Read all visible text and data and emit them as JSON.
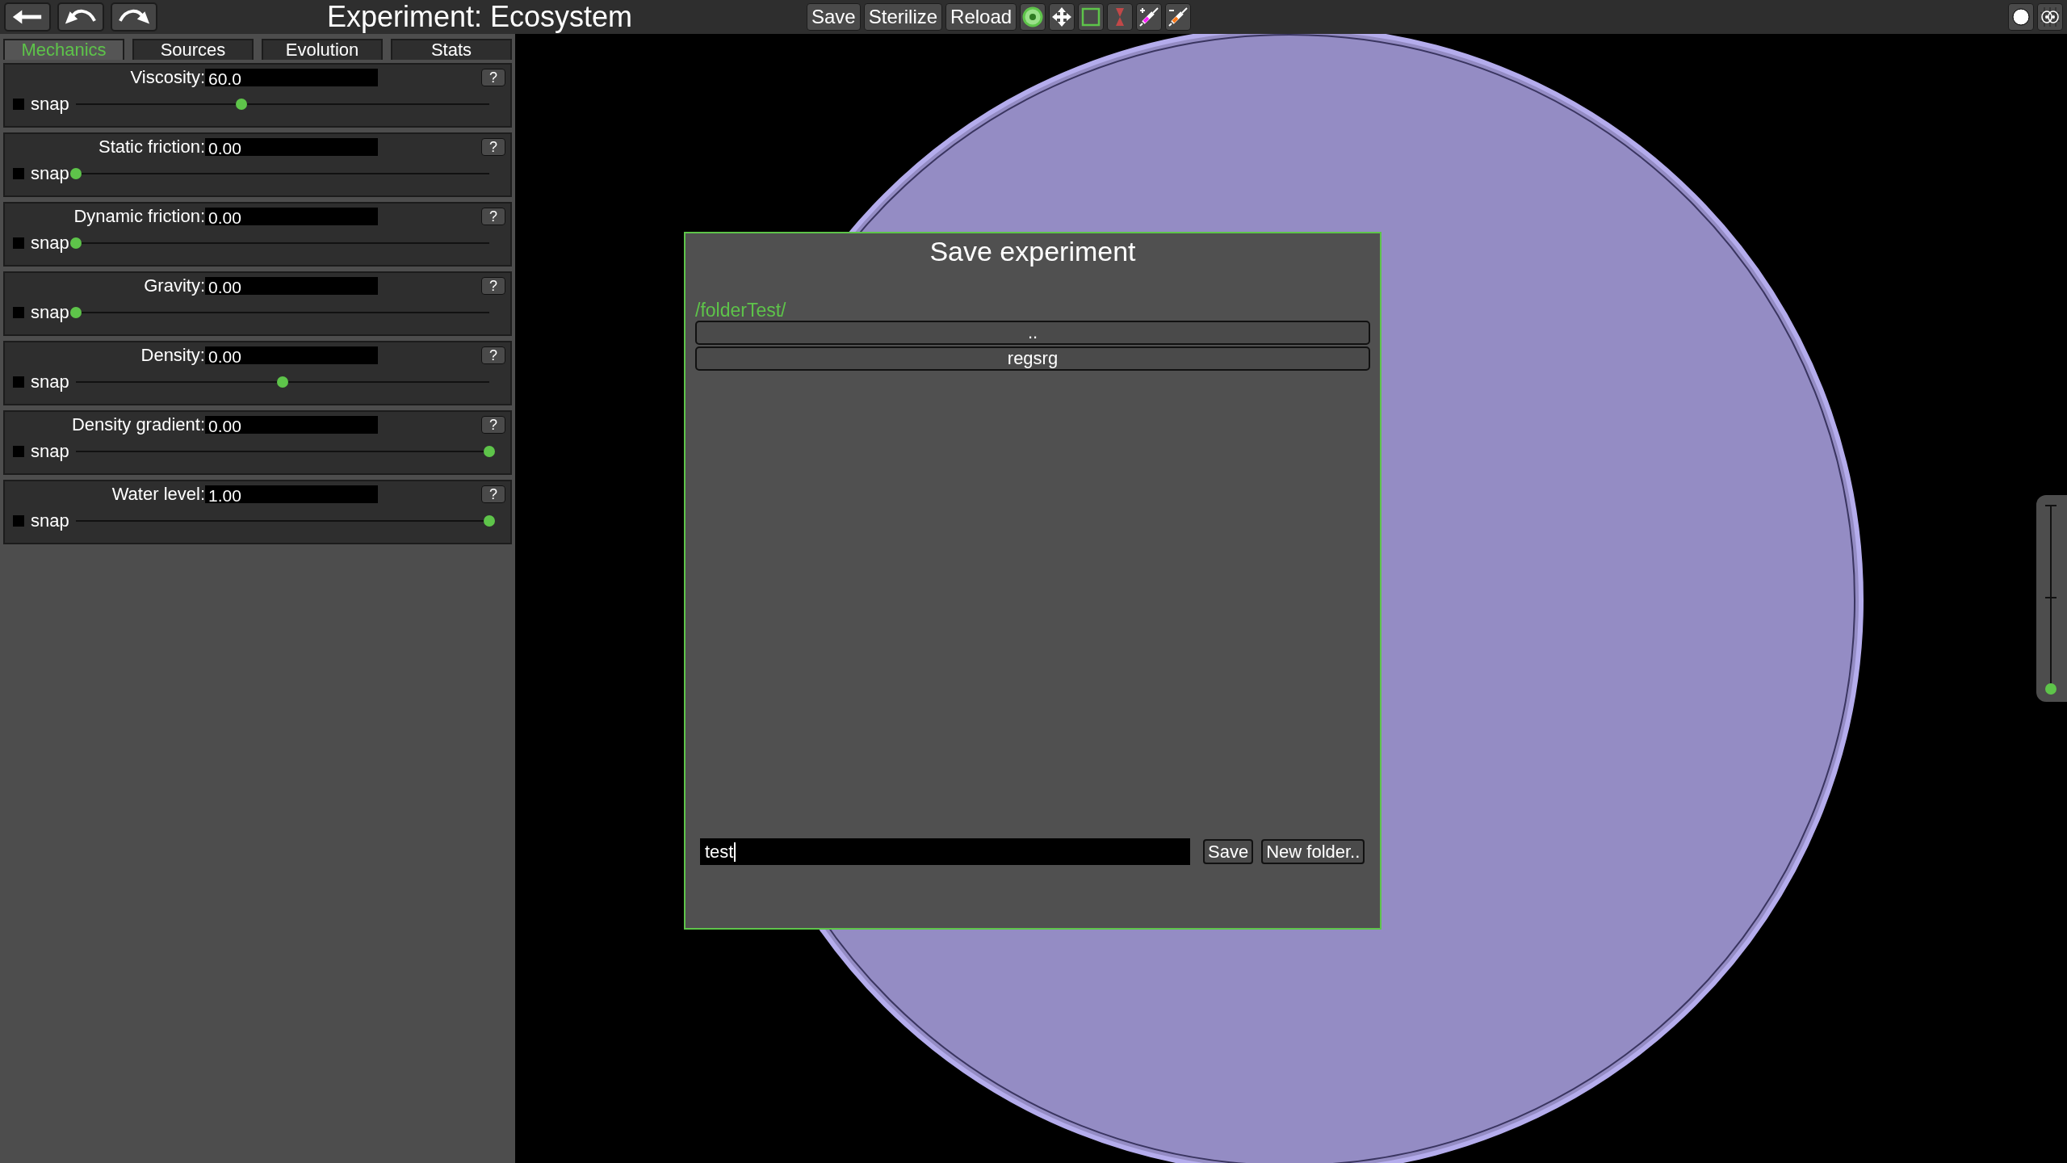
{
  "toolbar": {
    "title": "Experiment: Ecosystem",
    "buttons": [
      {
        "label": "Save"
      },
      {
        "label": "Sterilize"
      },
      {
        "label": "Reload"
      }
    ]
  },
  "tabs": [
    {
      "label": "Mechanics",
      "selected": true
    },
    {
      "label": "Sources",
      "selected": false
    },
    {
      "label": "Evolution",
      "selected": false
    },
    {
      "label": "Stats",
      "selected": false
    }
  ],
  "params": [
    {
      "label": "Viscosity:",
      "value": "60.0",
      "help": "?",
      "snap_label": "snap",
      "snap_checked": false,
      "level": 0.4
    },
    {
      "label": "Static friction:",
      "value": "0.00",
      "help": "?",
      "snap_label": "snap",
      "snap_checked": false,
      "level": 0
    },
    {
      "label": "Dynamic friction:",
      "value": "0.00",
      "help": "?",
      "snap_label": "snap",
      "snap_checked": false,
      "level": 0
    },
    {
      "label": "Gravity:",
      "value": "0.00",
      "help": "?",
      "snap_label": "snap",
      "snap_checked": false,
      "level": 0
    },
    {
      "label": "Density:",
      "value": "0.00",
      "help": "?",
      "snap_label": "snap",
      "snap_checked": false,
      "level": 0.5
    },
    {
      "label": "Density gradient:",
      "value": "0.00",
      "help": "?",
      "snap_label": "snap",
      "snap_checked": false,
      "level": 1
    },
    {
      "label": "Water level:",
      "value": "1.00",
      "help": "?",
      "snap_label": "snap",
      "snap_checked": false,
      "level": 1
    }
  ],
  "dialog": {
    "title": "Save experiment",
    "path": "/folderTest/",
    "entries": [
      {
        "name": ".."
      },
      {
        "name": "regsrg"
      }
    ],
    "filename": "test",
    "buttons": [
      {
        "label": "Save"
      },
      {
        "label": "New folder.."
      }
    ]
  },
  "zoom_slider": {
    "level": 0
  }
}
